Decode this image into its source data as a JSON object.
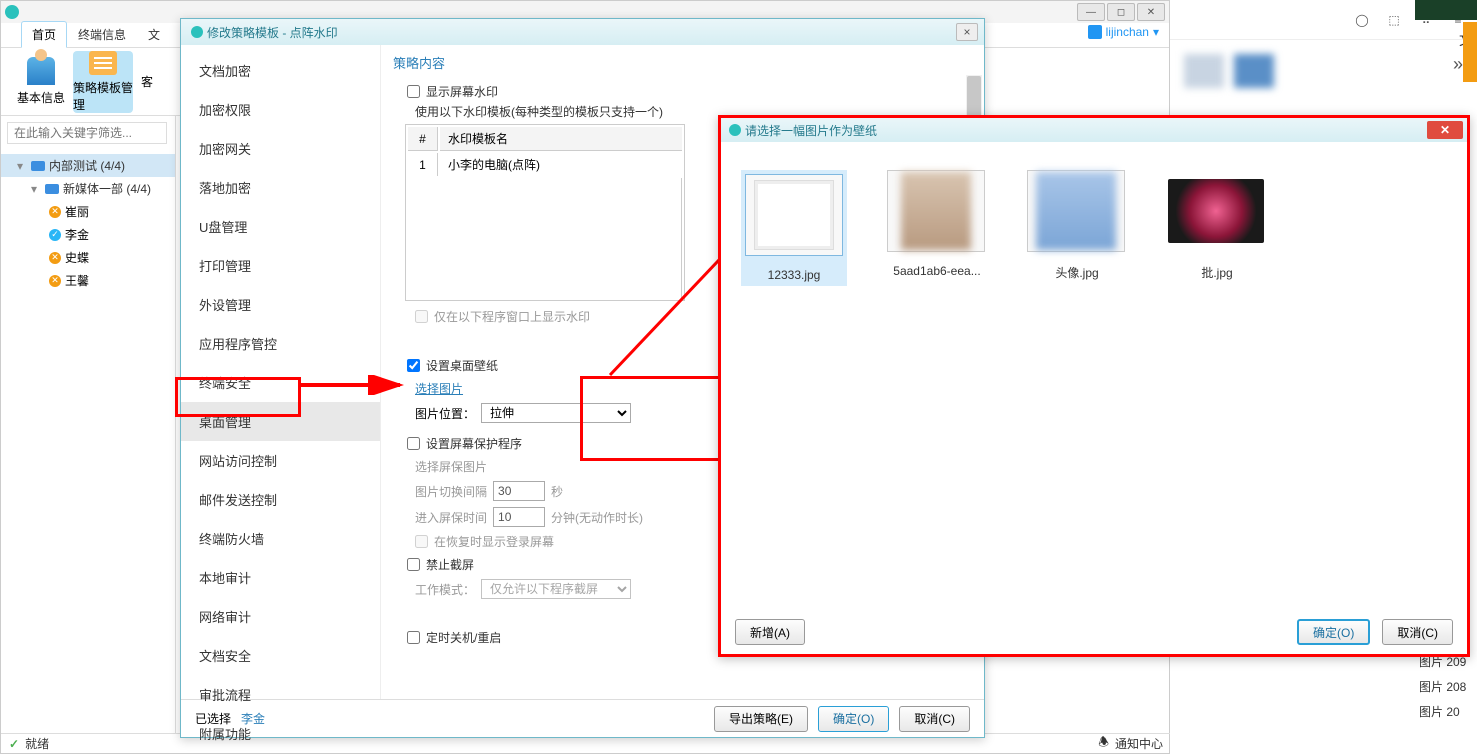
{
  "mainWindow": {
    "tabs": [
      "首页",
      "终端信息",
      "文"
    ],
    "activeTab": 0,
    "toolbar": [
      {
        "label": "基本信息"
      },
      {
        "label": "策略模板管理"
      },
      {
        "label": "客"
      }
    ],
    "activeTool": 1,
    "filterPlaceholder": "在此输入关键字筛选...",
    "tree": {
      "root": {
        "label": "内部测试 (4/4)"
      },
      "group": {
        "label": "新媒体一部 (4/4)"
      },
      "leaves": [
        {
          "label": "崔丽",
          "status": "warn"
        },
        {
          "label": "李金",
          "status": "ok"
        },
        {
          "label": "史蝶",
          "status": "warn"
        },
        {
          "label": "王馨",
          "status": "warn"
        }
      ]
    },
    "status": {
      "ready": "就绪",
      "notify": "通知中心"
    },
    "user": "lijinchan",
    "windowControls": [
      "—",
      "◻",
      "✕"
    ]
  },
  "policyDialog": {
    "title": "修改策略模板 - 点阵水印",
    "nav": [
      "文档加密",
      "加密权限",
      "加密网关",
      "落地加密",
      "U盘管理",
      "打印管理",
      "外设管理",
      "应用程序管控",
      "终端安全",
      "桌面管理",
      "网站访问控制",
      "邮件发送控制",
      "终端防火墙",
      "本地审计",
      "网络审计",
      "文档安全",
      "审批流程",
      "附属功能"
    ],
    "activeNav": 9,
    "contentTitle": "策略内容",
    "watermark": {
      "showLabel": "显示屏幕水印",
      "templateHint": "使用以下水印模板(每种类型的模板只支持一个)",
      "colHash": "#",
      "colName": "水印模板名",
      "rows": [
        {
          "n": "1",
          "name": "小李的电脑(点阵)"
        }
      ],
      "onlyProgramLabel": "仅在以下程序窗口上显示水印"
    },
    "wallpaper": {
      "setLabel": "设置桌面壁纸",
      "chooseImage": "选择图片",
      "posLabel": "图片位置：",
      "posValue": "拉伸"
    },
    "screensaver": {
      "setLabel": "设置屏幕保护程序",
      "chooseImage": "选择屏保图片",
      "intervalLabel": "图片切换间隔",
      "intervalVal": "30",
      "intervalUnit": "秒",
      "enterLabel": "进入屏保时间",
      "enterVal": "10",
      "enterUnit": "分钟(无动作时长)",
      "showLoginLabel": "在恢复时显示登录屏幕"
    },
    "forbidCapture": {
      "label": "禁止截屏",
      "modeLabel": "工作模式：",
      "modeValue": "仅允许以下程序截屏"
    },
    "shutdown": {
      "label": "定时关机/重启"
    },
    "footer": {
      "selectedPrefix": "已选择 ",
      "selectedName": "李金",
      "export": "导出策略(E)",
      "ok": "确定(O)",
      "cancel": "取消(C)"
    }
  },
  "imagePicker": {
    "title": "请选择一幅图片作为壁纸",
    "items": [
      {
        "label": "12333.jpg",
        "selected": true
      },
      {
        "label": "5aad1ab6-eea..."
      },
      {
        "label": "头像.jpg"
      },
      {
        "label": "批.jpg"
      }
    ],
    "add": "新增(A)",
    "ok": "确定(O)",
    "cancel": "取消(C)"
  },
  "browser": {
    "rightLabel": "文",
    "listItems": [
      "图片 209",
      "图片 208",
      "图片 20"
    ]
  }
}
